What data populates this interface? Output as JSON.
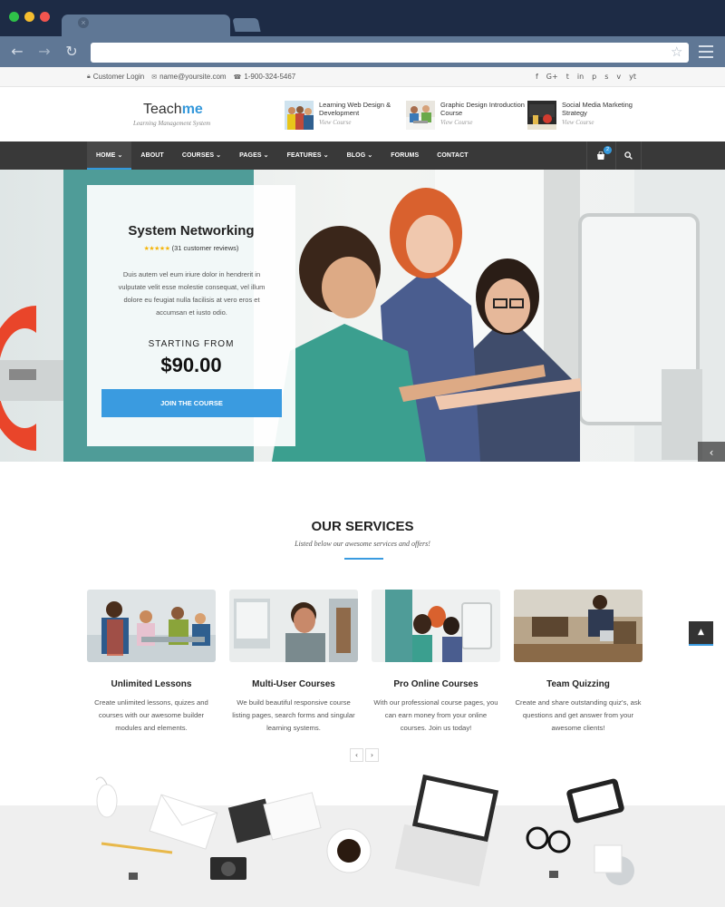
{
  "browser": {
    "dot_colors": [
      "#2fc149",
      "#f5bd2f",
      "#f2554f"
    ],
    "tab_close": "×",
    "back": "←",
    "forward": "→",
    "reload": "↻",
    "star": "☆"
  },
  "topbar": {
    "login": "Customer Login",
    "email": "name@yoursite.com",
    "phone": "1-900-324-5467",
    "social_icons": [
      "f",
      "G+",
      "t",
      "in",
      "p",
      "s",
      "v",
      "yt"
    ]
  },
  "header": {
    "logo_part1": "Teach",
    "logo_part2": "me",
    "tagline": "Learning Management System",
    "courses": [
      {
        "title": "Learning Web Design & Development",
        "cta": "View Course"
      },
      {
        "title": "Graphic Design Introduction Course",
        "cta": "View Course"
      },
      {
        "title": "Social Media Marketing Strategy",
        "cta": "View Course"
      }
    ]
  },
  "nav": {
    "items": [
      "HOME ⌄",
      "ABOUT",
      "COURSES ⌄",
      "PAGES ⌄",
      "FEATURES ⌄",
      "BLOG ⌄",
      "FORUMS",
      "CONTACT"
    ],
    "cart_count": "2"
  },
  "hero": {
    "title": "System Networking",
    "stars": "★★★★★",
    "reviews": "(31 customer reviews)",
    "description": "Duis autem vel eum iriure dolor in hendrerit in vulputate velit esse molestie consequat, vel illum dolore eu feugiat nulla facilisis at vero eros et accumsan et iusto odio.",
    "starting_label": "STARTING FROM",
    "price": "$90.00",
    "button": "JOIN THE COURSE",
    "arrow": "‹"
  },
  "services": {
    "heading": "OUR SERVICES",
    "subheading": "Listed below our awesome services and offers!",
    "cards": [
      {
        "title": "Unlimited Lessons",
        "desc": "Create unlimited lessons, quizes and courses with our awesome builder modules and elements."
      },
      {
        "title": "Multi-User Courses",
        "desc": "We build beautiful responsive course listing pages, search forms and singular learning systems."
      },
      {
        "title": "Pro Online Courses",
        "desc": "With our professional course pages, you can earn money from your online courses. Join us today!"
      },
      {
        "title": "Team Quizzing",
        "desc": "Create and share outstanding quiz's, ask questions and get answer from your awesome clients!"
      }
    ],
    "prev": "‹",
    "next": "›",
    "scroll_top": "▲"
  }
}
